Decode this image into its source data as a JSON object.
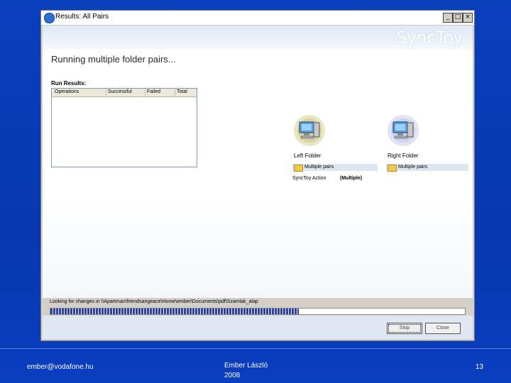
{
  "window": {
    "title": "Results: All Pairs",
    "minimize": "_",
    "maximize": "□",
    "close": "×"
  },
  "app": {
    "logo": "SyncToy",
    "heading": "Running multiple folder pairs..."
  },
  "results": {
    "label": "Run Results:",
    "columns": [
      "Operations",
      "Successful",
      "Failed",
      "Total"
    ]
  },
  "left_folder": {
    "title": "Left Folder",
    "path": "Multiple pairs"
  },
  "right_folder": {
    "title": "Right Folder",
    "path": "Multiple pairs"
  },
  "synctoy_action": {
    "label": "SyncToy Action",
    "value": "(Multiple)"
  },
  "status": {
    "text": "Looking for changes in \\\\Apartman\\friendsangeace\\Home\\ember\\Documents\\pdf\\Szamlak_alap",
    "progress": 0.6
  },
  "buttons": {
    "ok": "Stop",
    "close": "Close"
  },
  "footer": {
    "email": "ember@vodafone.hu",
    "author": "Ember László",
    "year": "2008",
    "page": "13"
  },
  "colors": {
    "slide_bg": "#0a3fbf",
    "progress": "#2b3fa8"
  }
}
